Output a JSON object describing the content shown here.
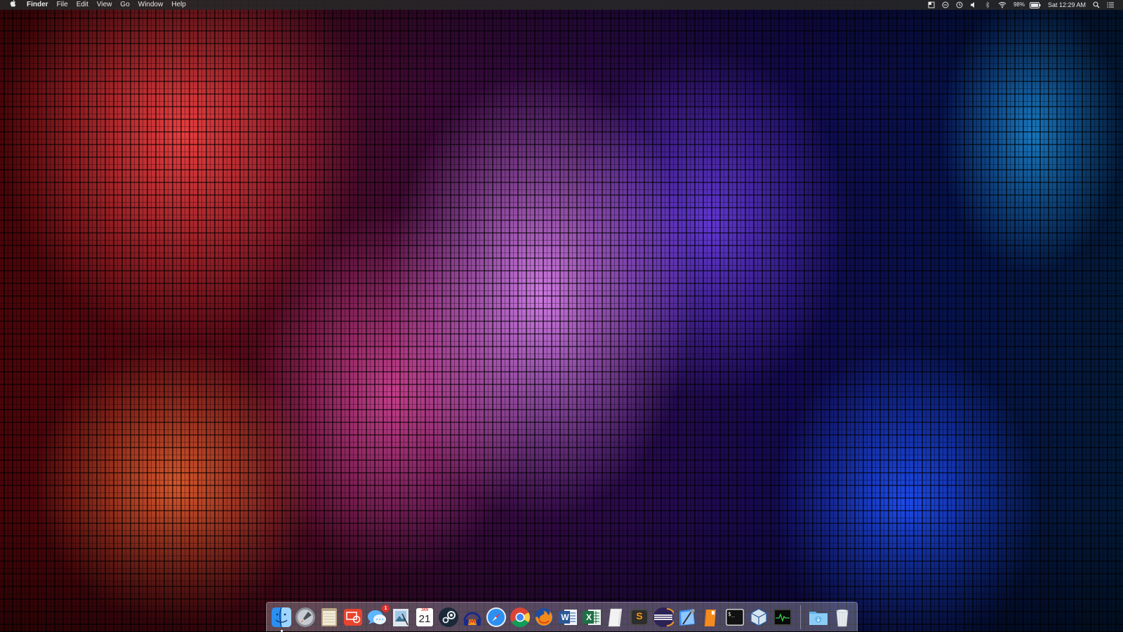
{
  "menubar": {
    "app_name": "Finder",
    "menus": [
      "File",
      "Edit",
      "View",
      "Go",
      "Window",
      "Help"
    ],
    "status": {
      "battery": "98%",
      "clock": "Sat 12:29 AM"
    }
  },
  "dock": {
    "items": [
      {
        "name": "Finder",
        "icon": "finder-icon",
        "running": true
      },
      {
        "name": "Launchpad",
        "icon": "launchpad-icon"
      },
      {
        "name": "Notes",
        "icon": "notes-icon"
      },
      {
        "name": "Remote Desktop",
        "icon": "remote-desktop-icon"
      },
      {
        "name": "Messages",
        "icon": "messages-icon",
        "badge": "1"
      },
      {
        "name": "Preview",
        "icon": "preview-icon"
      },
      {
        "name": "Calendar",
        "icon": "calendar-icon",
        "month": "JAN",
        "day": "21"
      },
      {
        "name": "Steam",
        "icon": "steam-icon"
      },
      {
        "name": "Audio App",
        "icon": "headphones-icon"
      },
      {
        "name": "Safari",
        "icon": "safari-icon"
      },
      {
        "name": "Chrome",
        "icon": "chrome-icon"
      },
      {
        "name": "Firefox",
        "icon": "firefox-icon"
      },
      {
        "name": "Word",
        "icon": "word-icon",
        "letter": "W"
      },
      {
        "name": "Excel",
        "icon": "excel-icon",
        "letter": "X"
      },
      {
        "name": "Text Editor",
        "icon": "paper-icon"
      },
      {
        "name": "Sublime Text",
        "icon": "sublime-icon",
        "letter": "S"
      },
      {
        "name": "Eclipse",
        "icon": "eclipse-icon"
      },
      {
        "name": "Xcode",
        "icon": "xcode-icon"
      },
      {
        "name": "iBooks",
        "icon": "ibooks-icon"
      },
      {
        "name": "Terminal",
        "icon": "terminal-icon",
        "prompt": "$_"
      },
      {
        "name": "VirtualBox",
        "icon": "virtualbox-icon"
      },
      {
        "name": "Activity Monitor",
        "icon": "activity-monitor-icon"
      },
      {
        "name": "Downloads",
        "icon": "downloads-folder-icon"
      },
      {
        "name": "Trash",
        "icon": "trash-icon"
      }
    ]
  }
}
